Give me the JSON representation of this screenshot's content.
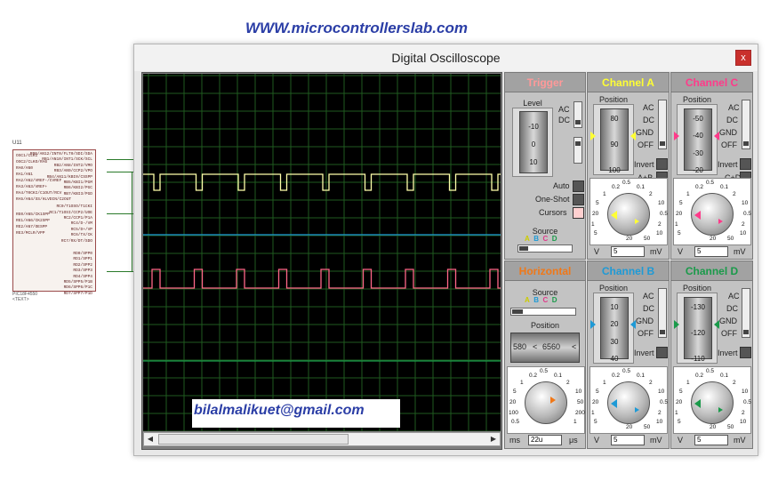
{
  "watermark": "WWW.microcontrollerslab.com",
  "schematic": {
    "chip_ref": "U11",
    "chip_name": "PIC18F4550",
    "chip_text": "<TEXT>",
    "left_pins": [
      "OSC1/CLKI",
      "OSC2/CLKO/RA6",
      "RA0/AN0",
      "RA1/AN1",
      "RA2/AN2/VREF-/CVREF",
      "RA3/AN3/VREF+",
      "RA4/T0CKI/C1OUT/RCV",
      "RA5/AN4/SS/HLVDIN/C2OUT",
      "RE0/AN5/CK1SPP",
      "RE1/AN6/CK2SPP",
      "RE2/AN7/OESPP",
      "RE3/MCLR/VPP"
    ],
    "right_pins": [
      "RB0/AN12/INT0/FLT0/SDI/SDA",
      "RB1/AN10/INT1/SCK/SCL",
      "RB2/AN8/INT2/VMO",
      "RB3/AN9/CCP2/VPO",
      "RB4/AN11/KBI0/CSSPP",
      "RB5/KBI1/PGM",
      "RB6/KBI2/PGC",
      "RB7/KBI3/PGD",
      "RC0/T1OSO/T1CKI",
      "RC1/T1OSI/CCP2/UOE",
      "RC2/CCP1/P1A",
      "RC4/D-/VM",
      "RC5/D+/VP",
      "RC6/TX/CK",
      "RC7/RX/DT/SDO",
      "RD0/SPP0",
      "RD1/SPP1",
      "RD2/SPP2",
      "RD3/SPP3",
      "RD4/SPP4",
      "RD5/SPP5/P1B",
      "RD6/SPP6/P1C",
      "RD7/SPP7/P1D"
    ]
  },
  "window": {
    "title": "Digital Oscilloscope",
    "close_label": "x"
  },
  "overlay_email": "bilalmalikuet@gmail.com",
  "trigger": {
    "title": "Trigger",
    "level_label": "Level",
    "drum_values": [
      "-10",
      "0",
      "10"
    ],
    "ac_label": "AC",
    "dc_label": "DC",
    "auto_label": "Auto",
    "oneshot_label": "One-Shot",
    "cursors_label": "Cursors",
    "source_label": "Source",
    "source_letters": [
      "A",
      "B",
      "C",
      "D"
    ]
  },
  "horizontal": {
    "title": "Horizontal",
    "source_label": "Source",
    "source_letters": [
      "A",
      "B",
      "C",
      "D"
    ],
    "position_label": "Position",
    "position_left": "580",
    "position_value": "6560",
    "position_lt": "<",
    "position_lt2": "<",
    "knob_ticks": [
      "0.5",
      "0.2",
      "0.1",
      "1",
      "2",
      "5",
      "10",
      "20",
      "50",
      "100",
      "200",
      "0.5",
      "1",
      "2",
      "5",
      "10",
      "20",
      "50"
    ],
    "unit_left": "ms",
    "unit_right": "μs",
    "value": "22u"
  },
  "channels": [
    {
      "id": "a",
      "title": "Channel A",
      "color": "#ffff33",
      "position_label": "Position",
      "drum_values": [
        "80",
        "90",
        "100"
      ],
      "ac": "AC",
      "dc": "DC",
      "gnd": "GND",
      "off": "OFF",
      "invert": "Invert",
      "extra": "A+B",
      "knob_ticks": [
        "0.5",
        "0.2",
        "0.1",
        "1",
        "2",
        "5",
        "10",
        "20",
        "0.5",
        "1",
        "2",
        "5",
        "10",
        "20",
        "50"
      ],
      "unit_left": "V",
      "value": "5",
      "unit_right": "mV"
    },
    {
      "id": "c",
      "title": "Channel C",
      "color": "#ff3a8a",
      "position_label": "Position",
      "drum_values": [
        "-50",
        "-40",
        "-30",
        "-20"
      ],
      "ac": "AC",
      "dc": "DC",
      "gnd": "GND",
      "off": "OFF",
      "invert": "Invert",
      "extra": "C+D",
      "knob_ticks": [
        "0.5",
        "0.2",
        "0.1",
        "1",
        "2",
        "5",
        "10",
        "20",
        "0.5",
        "1",
        "2",
        "5",
        "10",
        "20",
        "50"
      ],
      "unit_left": "V",
      "value": "5",
      "unit_right": "mV"
    },
    {
      "id": "b",
      "title": "Channel B",
      "color": "#1e9ad6",
      "position_label": "Position",
      "drum_values": [
        "10",
        "20",
        "30",
        "40"
      ],
      "ac": "AC",
      "dc": "DC",
      "gnd": "GND",
      "off": "OFF",
      "invert": "Invert",
      "extra": "",
      "knob_ticks": [
        "0.5",
        "0.2",
        "0.1",
        "1",
        "2",
        "5",
        "10",
        "20",
        "0.5",
        "1",
        "2",
        "5",
        "10",
        "20",
        "50"
      ],
      "unit_left": "V",
      "value": "5",
      "unit_right": "mV"
    },
    {
      "id": "d",
      "title": "Channel D",
      "color": "#1a9a4a",
      "position_label": "Position",
      "drum_values": [
        "-130",
        "-120",
        "-110"
      ],
      "ac": "AC",
      "dc": "DC",
      "gnd": "GND",
      "off": "OFF",
      "invert": "Invert",
      "extra": "",
      "knob_ticks": [
        "0.5",
        "0.2",
        "0.1",
        "1",
        "2",
        "5",
        "10",
        "20",
        "0.5",
        "1",
        "2",
        "5",
        "10",
        "20",
        "50"
      ],
      "unit_left": "V",
      "value": "5",
      "unit_right": "mV"
    }
  ],
  "colors": {
    "trace_a": "#ffffaa",
    "trace_b": "#1e9ad6",
    "trace_c": "#ff6688",
    "trace_d": "#1a9a4a",
    "grid": "#1f5a1f",
    "horizontal_title": "#f07818",
    "trigger_title": "#ff9999"
  },
  "icons": [
    "close-icon",
    "scroll-left-arrow-icon",
    "scroll-right-arrow-icon",
    "knob-icon",
    "drum-wheel-icon"
  ]
}
